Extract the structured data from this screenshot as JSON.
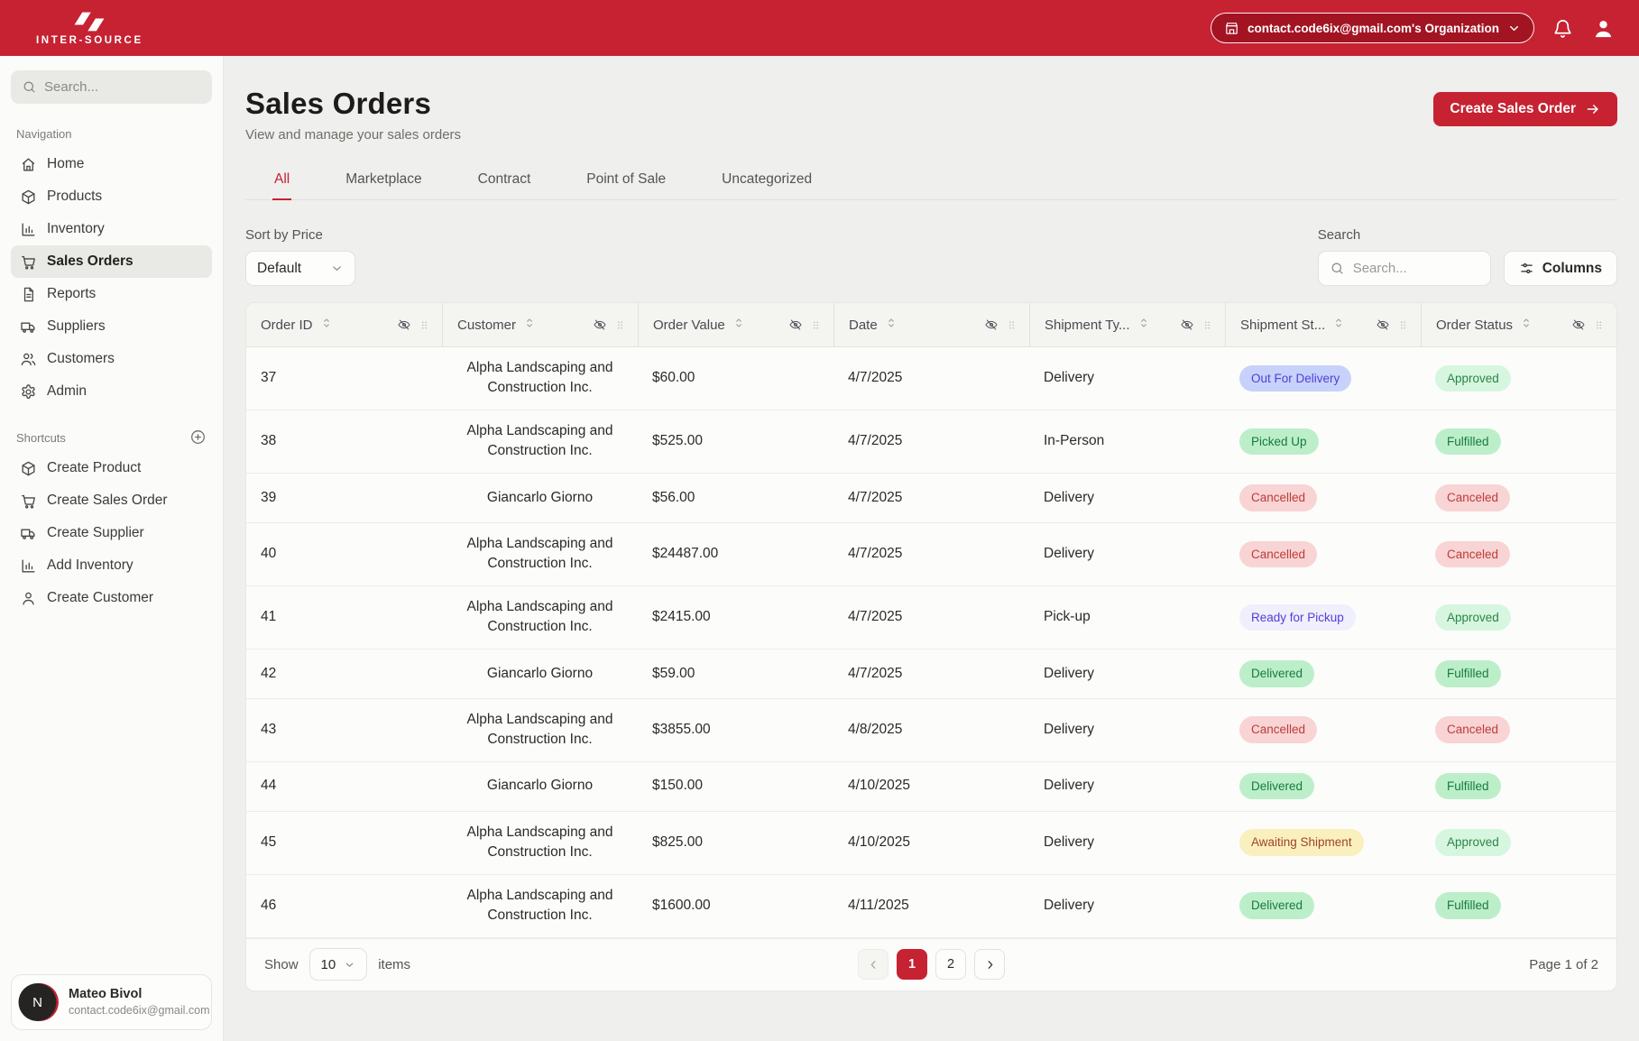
{
  "topbar": {
    "brand": "INTER-SOURCE",
    "org_button_label": "contact.code6ix@gmail.com's Organization"
  },
  "sidebar": {
    "search_placeholder": "Search...",
    "sections": {
      "navigation": "Navigation",
      "shortcuts": "Shortcuts"
    },
    "nav_items": [
      {
        "label": "Home",
        "icon": "home",
        "active": false
      },
      {
        "label": "Products",
        "icon": "box",
        "active": false
      },
      {
        "label": "Inventory",
        "icon": "chart",
        "active": false
      },
      {
        "label": "Sales Orders",
        "icon": "cart",
        "active": true
      },
      {
        "label": "Reports",
        "icon": "report",
        "active": false
      },
      {
        "label": "Suppliers",
        "icon": "truck",
        "active": false
      },
      {
        "label": "Customers",
        "icon": "users",
        "active": false
      },
      {
        "label": "Admin",
        "icon": "gear",
        "active": false
      }
    ],
    "shortcut_items": [
      {
        "label": "Create Product",
        "icon": "box"
      },
      {
        "label": "Create Sales Order",
        "icon": "cart"
      },
      {
        "label": "Create Supplier",
        "icon": "truck"
      },
      {
        "label": "Add Inventory",
        "icon": "chart"
      },
      {
        "label": "Create Customer",
        "icon": "user"
      }
    ],
    "user": {
      "initial": "N",
      "name": "Mateo Bivol",
      "email": "contact.code6ix@gmail.com"
    }
  },
  "page": {
    "title": "Sales Orders",
    "subtitle": "View and manage your sales orders",
    "create_button_label": "Create Sales Order"
  },
  "tabs": {
    "items": [
      "All",
      "Marketplace",
      "Contract",
      "Point of Sale",
      "Uncategorized"
    ],
    "active": "All"
  },
  "filters": {
    "sort_label": "Sort by Price",
    "sort_value": "Default",
    "search_label": "Search",
    "search_placeholder": "Search...",
    "columns_button_label": "Columns"
  },
  "table": {
    "columns": [
      "Order ID",
      "Customer",
      "Order Value",
      "Date",
      "Shipment Ty...",
      "Shipment St...",
      "Order Status"
    ],
    "rows": [
      {
        "id": "37",
        "customer": "Alpha Landscaping and Construction Inc.",
        "value": "$60.00",
        "date": "4/7/2025",
        "shipment_type": "Delivery",
        "shipment_status": "Out For Delivery",
        "order_status": "Approved"
      },
      {
        "id": "38",
        "customer": "Alpha Landscaping and Construction Inc.",
        "value": "$525.00",
        "date": "4/7/2025",
        "shipment_type": "In-Person",
        "shipment_status": "Picked Up",
        "order_status": "Fulfilled"
      },
      {
        "id": "39",
        "customer": "Giancarlo Giorno",
        "value": "$56.00",
        "date": "4/7/2025",
        "shipment_type": "Delivery",
        "shipment_status": "Cancelled",
        "order_status": "Canceled"
      },
      {
        "id": "40",
        "customer": "Alpha Landscaping and Construction Inc.",
        "value": "$24487.00",
        "date": "4/7/2025",
        "shipment_type": "Delivery",
        "shipment_status": "Cancelled",
        "order_status": "Canceled"
      },
      {
        "id": "41",
        "customer": "Alpha Landscaping and Construction Inc.",
        "value": "$2415.00",
        "date": "4/7/2025",
        "shipment_type": "Pick-up",
        "shipment_status": "Ready for Pickup",
        "order_status": "Approved"
      },
      {
        "id": "42",
        "customer": "Giancarlo Giorno",
        "value": "$59.00",
        "date": "4/7/2025",
        "shipment_type": "Delivery",
        "shipment_status": "Delivered",
        "order_status": "Fulfilled"
      },
      {
        "id": "43",
        "customer": "Alpha Landscaping and Construction Inc.",
        "value": "$3855.00",
        "date": "4/8/2025",
        "shipment_type": "Delivery",
        "shipment_status": "Cancelled",
        "order_status": "Canceled"
      },
      {
        "id": "44",
        "customer": "Giancarlo Giorno",
        "value": "$150.00",
        "date": "4/10/2025",
        "shipment_type": "Delivery",
        "shipment_status": "Delivered",
        "order_status": "Fulfilled"
      },
      {
        "id": "45",
        "customer": "Alpha Landscaping and Construction Inc.",
        "value": "$825.00",
        "date": "4/10/2025",
        "shipment_type": "Delivery",
        "shipment_status": "Awaiting Shipment",
        "order_status": "Approved"
      },
      {
        "id": "46",
        "customer": "Alpha Landscaping and Construction Inc.",
        "value": "$1600.00",
        "date": "4/11/2025",
        "shipment_type": "Delivery",
        "shipment_status": "Delivered",
        "order_status": "Fulfilled"
      }
    ]
  },
  "pagination": {
    "show_label": "Show",
    "page_size": "10",
    "items_label": "items",
    "pages": [
      "1",
      "2"
    ],
    "current_page": "1",
    "page_info": "Page 1 of 2"
  },
  "colors": {
    "brand_red": "#C62232",
    "badge_colors": {
      "out_for_delivery": {
        "bg": "#C7D2FA",
        "text": "#4F3ED8"
      },
      "picked_up": {
        "bg": "#BCEFC9",
        "text": "#177A3E"
      },
      "delivered": {
        "bg": "#BCEFC9",
        "text": "#177A3E"
      },
      "fulfilled": {
        "bg": "#BCEFC9",
        "text": "#177A3E"
      },
      "cancelled": {
        "bg": "#F8D4D4",
        "text": "#BE3B3B"
      },
      "canceled": {
        "bg": "#F8D4D4",
        "text": "#BE3B3B"
      },
      "ready_for_pickup": {
        "bg": "#F0EFFC",
        "text": "#4F3ED8"
      },
      "awaiting_shipment": {
        "bg": "#FAF0BE",
        "text": "#A04327"
      },
      "approved": {
        "bg": "#D6F6DF",
        "text": "#2B8547"
      }
    }
  }
}
